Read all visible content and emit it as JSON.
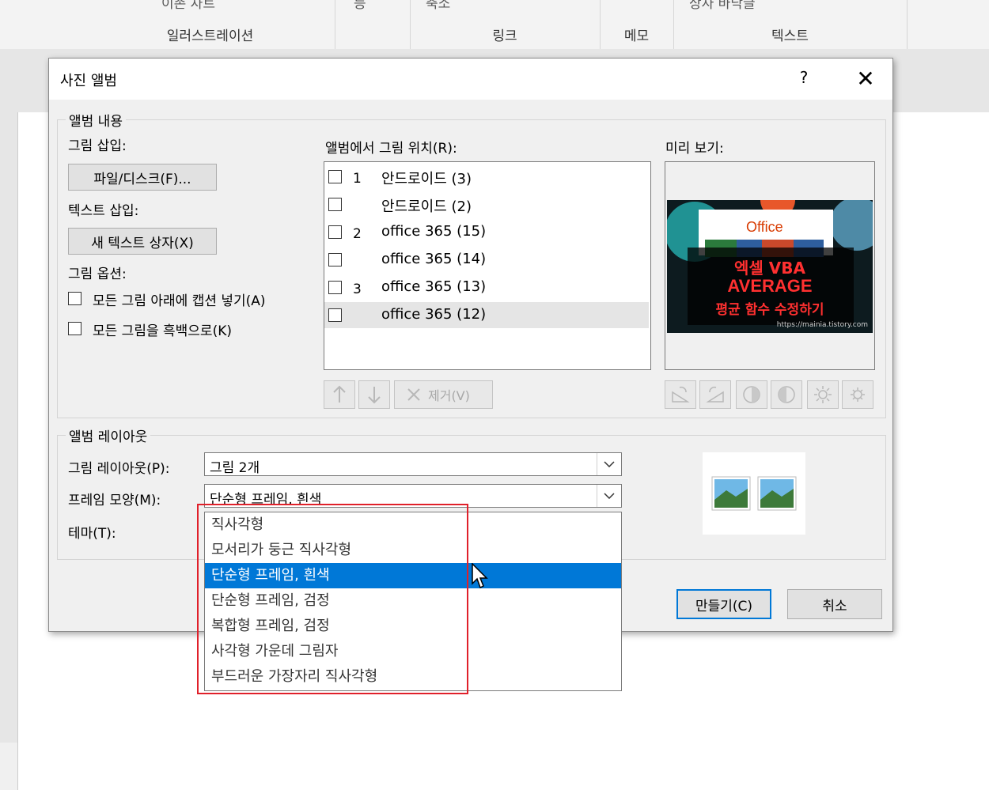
{
  "ribbon": {
    "groups": [
      {
        "label": "일러스트레이션",
        "top": "이존  차트"
      },
      {
        "label": "",
        "top": "등"
      },
      {
        "label": "링크",
        "top": "축소"
      },
      {
        "label": "메모",
        "top": ""
      },
      {
        "label": "텍스트",
        "top": "상자   바닥글"
      }
    ]
  },
  "dialog": {
    "title": "사진 앨범",
    "help": "?",
    "close": "✕",
    "album_content": {
      "legend": "앨범 내용",
      "insert_picture_label": "그림 삽입:",
      "file_button": "파일/디스크(F)...",
      "insert_text_label": "텍스트 삽입:",
      "new_textbox_button": "새 텍스트 상자(X)",
      "picture_options_label": "그림 옵션:",
      "caption_option": "모든 그림 아래에 캡션 넣기(A)",
      "bw_option": "모든 그림을 흑백으로(K)",
      "position_label": "앨범에서 그림 위치(R):",
      "pictures": [
        {
          "num": "1",
          "name": "안드로이드 (3)"
        },
        {
          "num": "",
          "name": "안드로이드 (2)"
        },
        {
          "num": "2",
          "name": "office 365 (15)"
        },
        {
          "num": "",
          "name": "office 365 (14)"
        },
        {
          "num": "3",
          "name": "office 365 (13)"
        },
        {
          "num": "",
          "name": "office 365 (12)"
        }
      ],
      "remove_button": "제거(V)",
      "preview_label": "미리 보기:",
      "preview": {
        "logo": "Office",
        "line1": "엑셀 VBA",
        "line2": "AVERAGE",
        "line3": "평균 함수 수정하기",
        "url": "https://mainia.tistory.com"
      }
    },
    "album_layout": {
      "legend": "앨범 레이아웃",
      "picture_layout_label": "그림 레이아웃(P):",
      "picture_layout_value": "그림 2개",
      "frame_shape_label": "프레임 모양(M):",
      "frame_shape_value": "단순형 프레임, 흰색",
      "theme_label": "테마(T):",
      "frame_options": [
        "직사각형",
        "모서리가 둥근 직사각형",
        "단순형 프레임, 흰색",
        "단순형 프레임, 검정",
        "복합형 프레임, 검정",
        "사각형 가운데 그림자",
        "부드러운 가장자리 직사각형"
      ]
    },
    "create_button": "만들기(C)",
    "cancel_button": "취소"
  },
  "colors": {
    "highlight": "#0078d7",
    "annotation": "#e0202a"
  }
}
